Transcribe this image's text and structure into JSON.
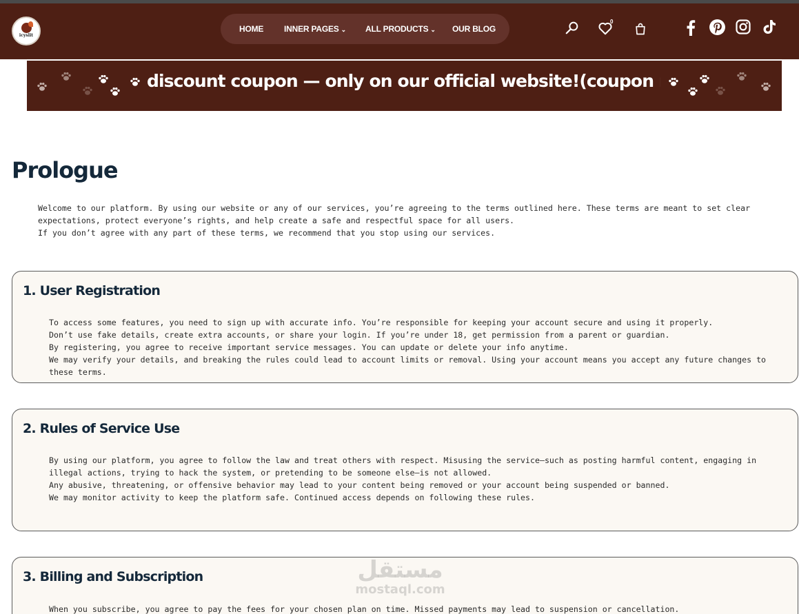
{
  "header": {
    "logo_text": "icyslit",
    "nav": [
      {
        "label": "HOME",
        "has_caret": false
      },
      {
        "label": "INNER PAGES",
        "has_caret": true
      },
      {
        "label": "ALL PRODUCTS",
        "has_caret": true
      },
      {
        "label": "OUR BLOG",
        "has_caret": false
      }
    ],
    "caret": "⌄",
    "wishlist_count": "0",
    "icons": [
      "search-icon",
      "heart-icon",
      "bag-icon",
      "facebook-icon",
      "pinterest-icon",
      "instagram-icon",
      "tiktok-icon"
    ]
  },
  "banner": {
    "text": "discount coupon — only on our official website!(coupon name: save"
  },
  "page": {
    "title": "Prologue",
    "intro": [
      "Welcome to our platform. By using our website or any of our services, you’re agreeing to the terms outlined here. These terms are meant to set clear expectations, protect everyone’s rights, and help create a safe and respectful space for all users.",
      "If you don’t agree with any part of these terms, we recommend that you stop using our services."
    ]
  },
  "sections": [
    {
      "title": "1. User Registration",
      "paragraphs": [
        "To access some features, you need to sign up with accurate info. You’re responsible for keeping your account secure and using it properly.",
        "Don’t use fake details, create extra accounts, or share your login. If you’re under 18, get permission from a parent or guardian.",
        "By registering, you agree to receive important service messages. You can update or delete your info anytime.",
        "We may verify your details, and breaking the rules could lead to account limits or removal. Using your account means you accept any future changes to these terms."
      ]
    },
    {
      "title": "2. Rules of Service Use",
      "paragraphs": [
        "By using our platform, you agree to follow the law and treat others with respect. Misusing the service—such as posting harmful content, engaging in illegal actions, trying to hack the system, or pretending to be someone else—is not allowed.",
        "Any abusive, threatening, or offensive behavior may lead to your content being removed or your account being suspended or banned.",
        "We may monitor activity to keep the platform safe. Continued access depends on following these rules."
      ]
    },
    {
      "title": "3. Billing and Subscription",
      "paragraphs": [
        "When you subscribe, you agree to pay the fees for your chosen plan on time. Missed payments may lead to suspension or cancellation."
      ]
    }
  ],
  "watermark": {
    "arabic": "مستقل",
    "latin": "mostaql.com"
  },
  "colors": {
    "header_bg": "#4e1f14",
    "menu_pill": "#63322a",
    "heading": "#14283a",
    "card_bg": "#fbf8f3"
  }
}
